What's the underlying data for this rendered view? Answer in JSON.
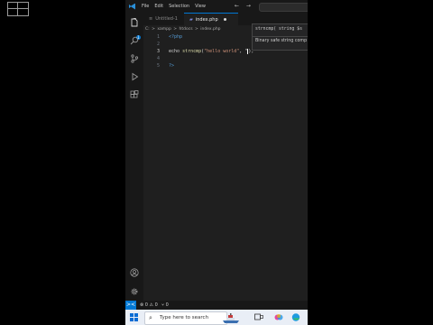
{
  "menu": [
    "File",
    "Edit",
    "Selection",
    "View"
  ],
  "nav_arrows": "← →",
  "tabs": [
    {
      "label": "Untitled-1",
      "icon": "≡"
    },
    {
      "label": "index.php",
      "icon": "▰",
      "modified": true
    }
  ],
  "breadcrumb": {
    "parts": [
      "C:",
      ">",
      "xampp",
      ">",
      "htdocs",
      ">",
      "index.php"
    ]
  },
  "editor": {
    "lines": [
      {
        "num": "1",
        "tokens": [
          {
            "c": "kw",
            "t": "<?php"
          }
        ]
      },
      {
        "num": "2",
        "tokens": []
      },
      {
        "num": "3",
        "active": true,
        "tokens": [
          {
            "c": "plain",
            "t": "echo "
          },
          {
            "c": "fn",
            "t": "strncmp"
          },
          {
            "c": "plain",
            "t": "("
          },
          {
            "c": "str",
            "t": "\"hello world\""
          },
          {
            "c": "plain",
            "t": ", \""
          },
          {
            "c": "cursor",
            "t": ""
          },
          {
            "c": "plain",
            "t": ");"
          }
        ]
      },
      {
        "num": "4",
        "tokens": []
      },
      {
        "num": "5",
        "tokens": [
          {
            "c": "kw",
            "t": "?>"
          }
        ]
      }
    ]
  },
  "hint": {
    "signature": "strncmp( string $s",
    "description": "Binary safe string comp"
  },
  "status": {
    "remote": "><",
    "problems": "⊗ 0 ⚠ 0",
    "ports": "⑂ 0"
  },
  "taskbar": {
    "search_placeholder": "Type here to search",
    "search_icon": "magnifier"
  },
  "colors": {
    "accent": "#0078d4",
    "editor_bg": "#1f1f1f",
    "taskbar_bg": "#e9eef6"
  }
}
